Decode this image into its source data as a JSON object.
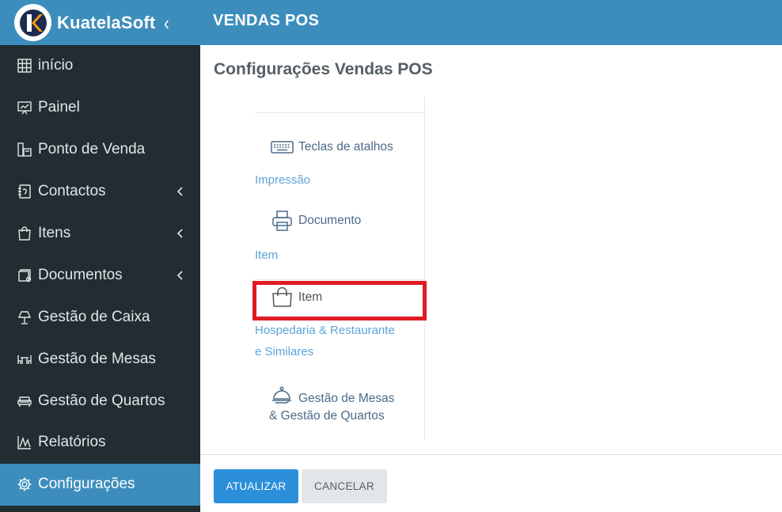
{
  "brand": {
    "name": "KuatelaSoft",
    "collapse_icon": "chevron-left-icon"
  },
  "header": {
    "title": "VENDAS POS"
  },
  "page": {
    "title": "Configurações Vendas POS"
  },
  "sidebar": {
    "items": [
      {
        "label": "início",
        "icon": "grid-icon"
      },
      {
        "label": "Painel",
        "icon": "presentation-board-icon"
      },
      {
        "label": "Ponto de Venda",
        "icon": "pos-terminal-icon"
      },
      {
        "label": "Contactos",
        "icon": "address-book-icon",
        "expandable": true
      },
      {
        "label": "Itens",
        "icon": "shopping-bag-icon",
        "expandable": true
      },
      {
        "label": "Documentos",
        "icon": "documents-icon",
        "expandable": true
      },
      {
        "label": "Gestão de Caixa",
        "icon": "lamp-icon"
      },
      {
        "label": "Gestão de Mesas",
        "icon": "table-chairs-icon"
      },
      {
        "label": "Gestão de Quartos",
        "icon": "sofa-icon"
      },
      {
        "label": "Relatórios",
        "icon": "chart-icon"
      },
      {
        "label": "Configurações",
        "icon": "gear-icon",
        "active": true
      }
    ]
  },
  "settings_tabs": {
    "shortcuts": {
      "label": "Teclas de atalhos",
      "icon": "keyboard-icon"
    },
    "section_print": "Impressão",
    "document": {
      "label": "Documento",
      "icon": "printer-icon"
    },
    "section_item": "Item",
    "item": {
      "label": "Item",
      "icon": "shopping-bag-icon",
      "selected": true
    },
    "section_hospitality_line1": "Hospedaria & Restaurante",
    "section_hospitality_line2": "e Similares",
    "tables_rooms_line1": "Gestão de Mesas",
    "tables_rooms_line2": "& Gestão de Quartos",
    "tables_rooms_icon": "cloche-icon"
  },
  "footer": {
    "update_label": "ATUALIZAR",
    "cancel_label": "CANCELAR"
  },
  "colors": {
    "primary": "#3c8dbc",
    "sidebar_bg": "#222d32",
    "highlight": "#e01b24",
    "button_primary": "#2b8fd9"
  }
}
